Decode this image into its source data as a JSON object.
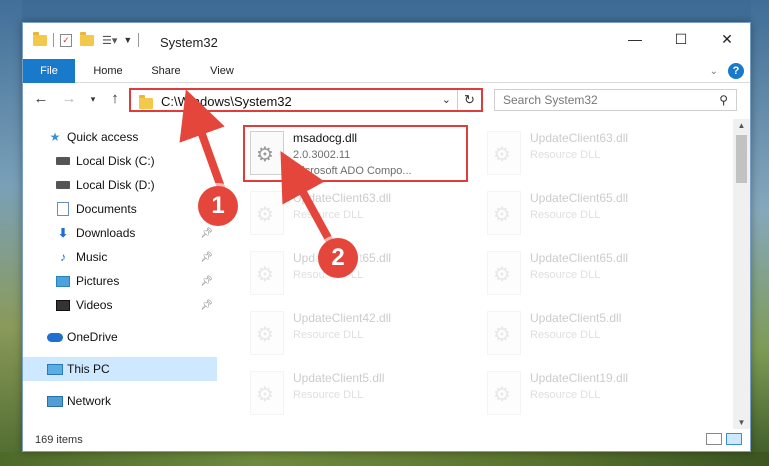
{
  "window": {
    "title": "System32",
    "controls": {
      "minimize": "—",
      "maximize": "☐",
      "close": "✕"
    }
  },
  "ribbon": {
    "tabs": [
      "File",
      "Home",
      "Share",
      "View"
    ],
    "help": "?"
  },
  "address": {
    "path": "C:\\Windows\\System32",
    "refresh": "↻"
  },
  "search": {
    "placeholder": "Search System32"
  },
  "sidebar": {
    "items": [
      {
        "label": "Quick access"
      },
      {
        "label": "Local Disk (C:)"
      },
      {
        "label": "Local Disk (D:)"
      },
      {
        "label": "Documents"
      },
      {
        "label": "Downloads"
      },
      {
        "label": "Music"
      },
      {
        "label": "Pictures"
      },
      {
        "label": "Videos"
      },
      {
        "label": "OneDrive"
      },
      {
        "label": "This PC"
      },
      {
        "label": "Network"
      }
    ]
  },
  "files": [
    {
      "name": "msadocg.dll",
      "version": "2.0.3002.11",
      "description": "Microsoft ADO Compo..."
    },
    {
      "name": "UpdateClient63.dll",
      "description": "Resource DLL"
    },
    {
      "name": "UpdateClient63.dll",
      "description": "Resource DLL"
    },
    {
      "name": "UpdateClient65.dll",
      "description": "Resource DLL"
    },
    {
      "name": "UpdateClient65.dll",
      "description": "Resource DLL"
    },
    {
      "name": "UpdateClient65.dll",
      "description": "Resource DLL"
    },
    {
      "name": "UpdateClient42.dll",
      "description": "Resource DLL"
    },
    {
      "name": "UpdateClient5.dll",
      "description": "Resource DLL"
    },
    {
      "name": "UpdateClient5.dll",
      "description": "Resource DLL"
    },
    {
      "name": "UpdateClient19.dll",
      "description": "Resource DLL"
    }
  ],
  "status": {
    "item_count": "169 items"
  },
  "annotations": {
    "step1": "1",
    "step2": "2",
    "color": "#e5463c"
  }
}
